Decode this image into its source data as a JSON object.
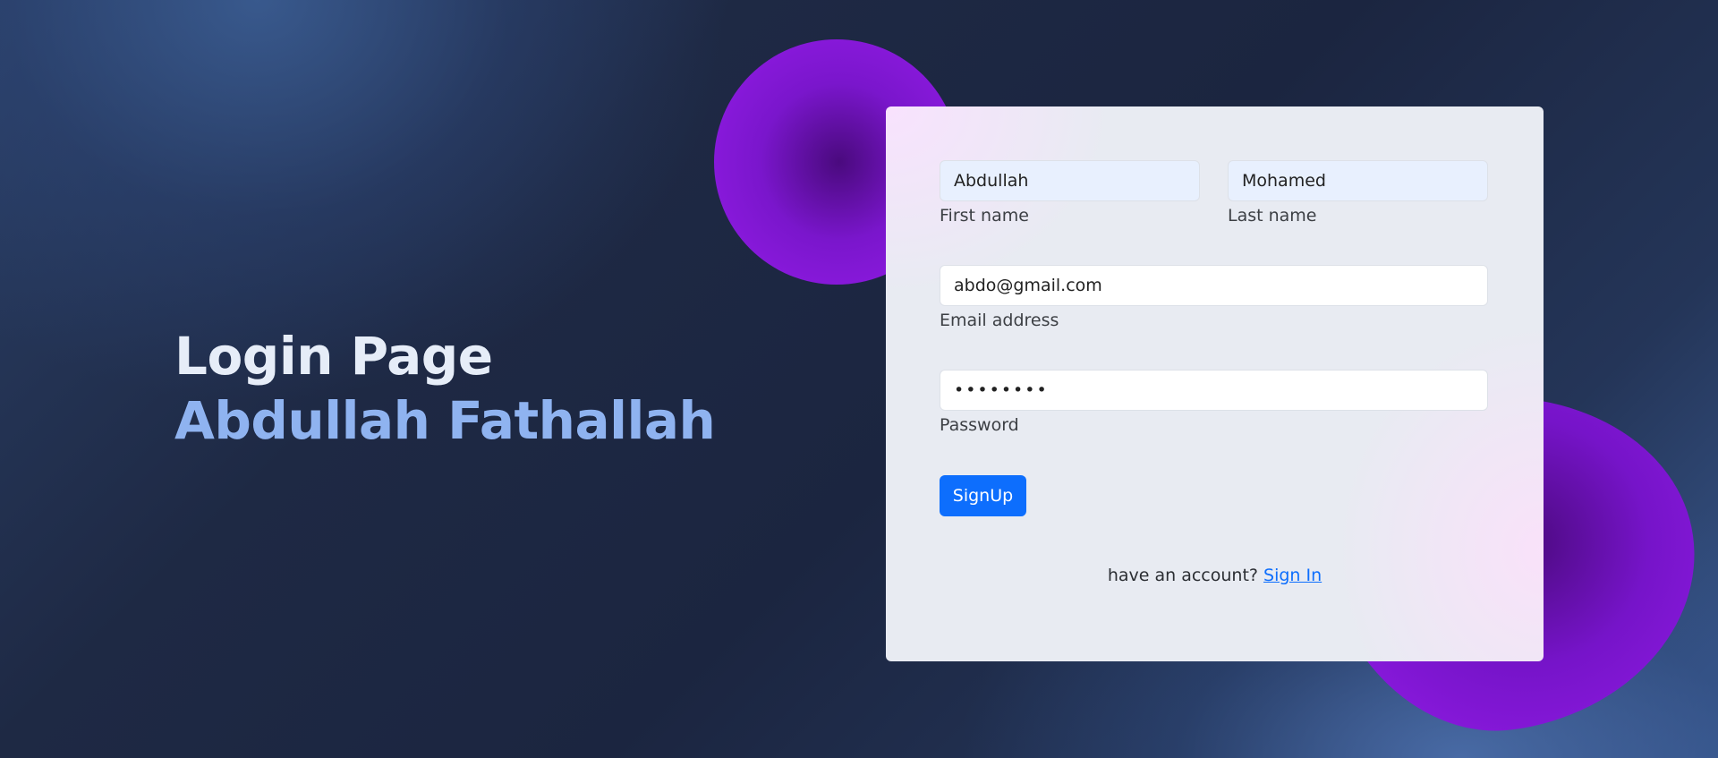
{
  "hero": {
    "title": "Login Page",
    "subtitle": "Abdullah Fathallah"
  },
  "form": {
    "first_name": {
      "value": "Abdullah",
      "label": "First name"
    },
    "last_name": {
      "value": "Mohamed",
      "label": "Last name"
    },
    "email": {
      "value": "abdo@gmail.com",
      "label": "Email address"
    },
    "password": {
      "value": "••••••••",
      "label": "Password"
    },
    "submit_label": "SignUp",
    "account_prompt": "have an account?",
    "signin_link": "Sign In"
  },
  "colors": {
    "accent": "#0d6efd",
    "blob": "#7a16cc",
    "hero_title": "#e6edf8",
    "hero_subtitle": "#8fb3f0"
  }
}
